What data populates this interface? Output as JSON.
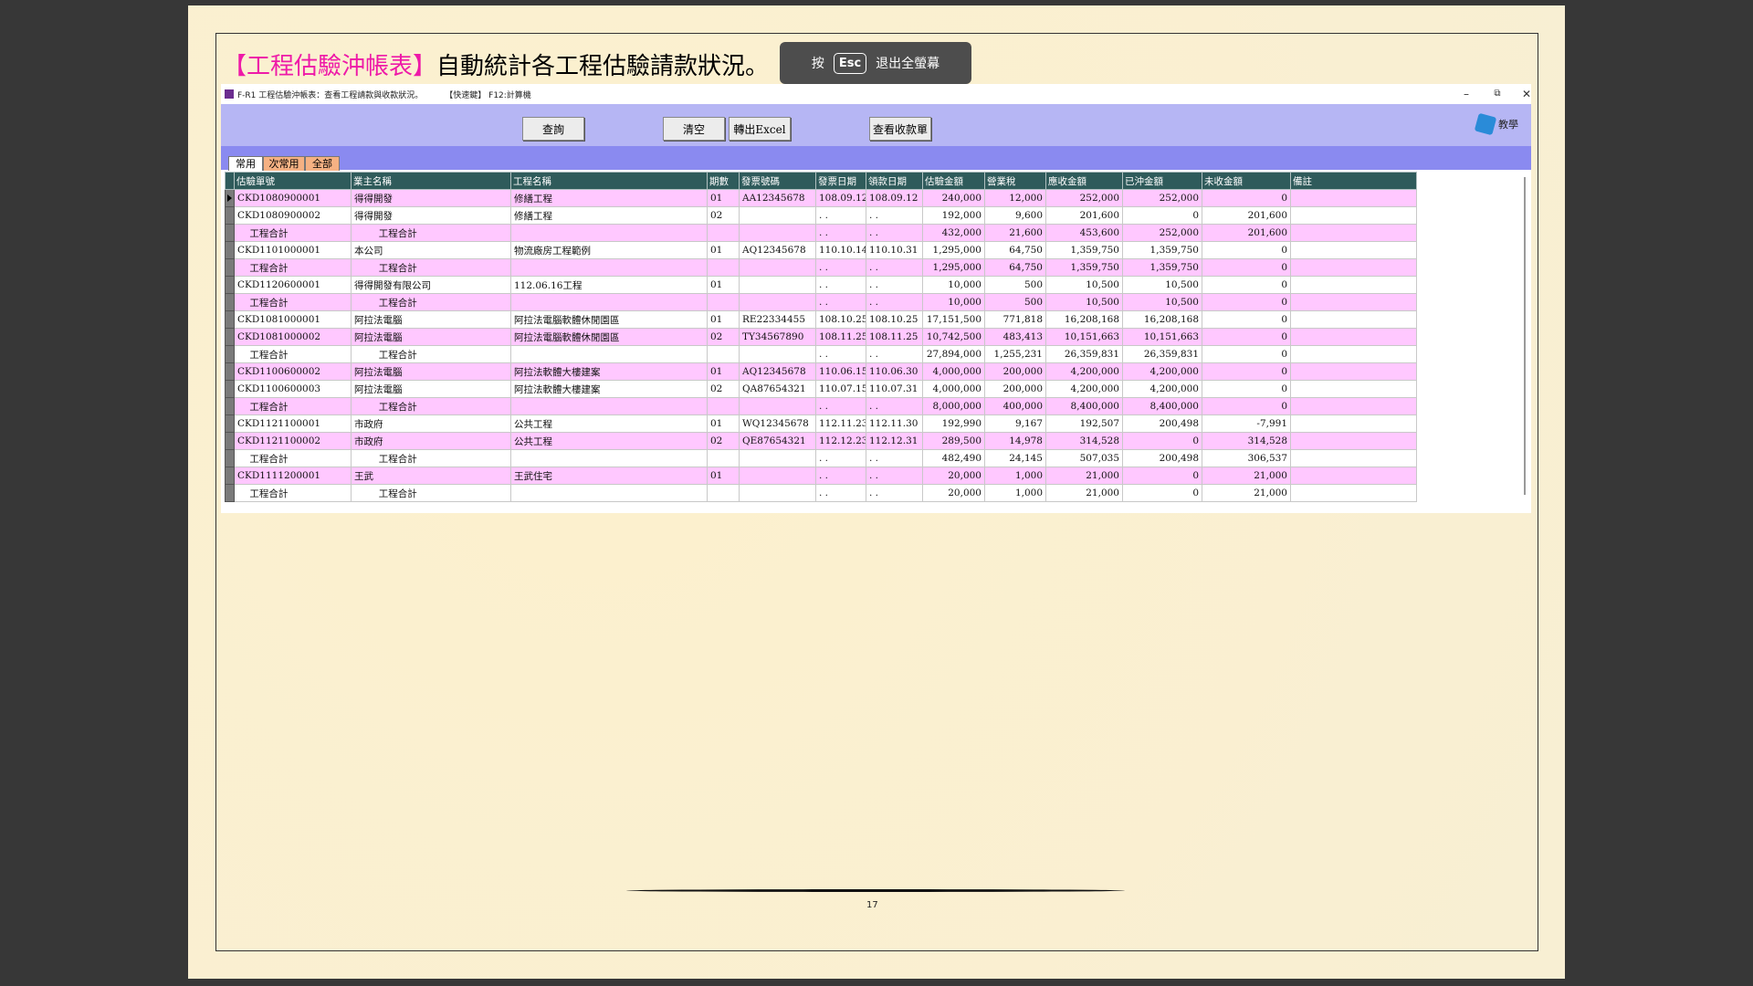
{
  "heading": {
    "bracket_title": "【工程估驗沖帳表】",
    "description": "自動統計各工程估驗請款狀況。"
  },
  "esc_hint": {
    "press": "按",
    "key": "Esc",
    "action": "退出全螢幕"
  },
  "window": {
    "title": "F-R1 工程估驗沖帳表：查看工程請款與收款狀況。",
    "hotkeys": "【快速鍵】 F12:計算機",
    "minimize": "–",
    "restore": "⧉",
    "close": "✕"
  },
  "toolbar": {
    "query": "查詢",
    "clear": "清空",
    "export": "轉出Excel",
    "view_receipts": "查看收款單",
    "help": "教學"
  },
  "tabs": [
    "常用",
    "次常用",
    "全部"
  ],
  "colors": {
    "toolbar": "#b6b6f4",
    "header": "#2f5b5b",
    "pink_row": "#ffc8ff",
    "accent": "#ee1aa8"
  },
  "table": {
    "columns": [
      "估驗單號",
      "業主名稱",
      "工程名稱",
      "期數",
      "發票號碼",
      "發票日期",
      "領款日期",
      "估驗金額",
      "營業稅",
      "應收金額",
      "已沖金額",
      "未收金額",
      "備註"
    ],
    "rows": [
      {
        "style": "pink",
        "c": [
          "CKD1080900001",
          "得得開發",
          "修繕工程",
          "01",
          "AA12345678",
          "108.09.12",
          "108.09.12",
          "240,000",
          "12,000",
          "252,000",
          "252,000",
          "0",
          ""
        ]
      },
      {
        "style": "white",
        "c": [
          "CKD1080900002",
          "得得開發",
          "修繕工程",
          "02",
          "",
          ". .",
          ". .",
          "192,000",
          "9,600",
          "201,600",
          "0",
          "201,600",
          ""
        ]
      },
      {
        "style": "pink",
        "c": [
          "    工程合計",
          "        工程合計",
          "",
          "",
          "",
          ". .",
          ". .",
          "432,000",
          "21,600",
          "453,600",
          "252,000",
          "201,600",
          ""
        ]
      },
      {
        "style": "white",
        "c": [
          "CKD1101000001",
          "本公司",
          "物流廠房工程範例",
          "01",
          "AQ12345678",
          "110.10.14",
          "110.10.31",
          "1,295,000",
          "64,750",
          "1,359,750",
          "1,359,750",
          "0",
          ""
        ]
      },
      {
        "style": "pink",
        "c": [
          "    工程合計",
          "        工程合計",
          "",
          "",
          "",
          ". .",
          ". .",
          "1,295,000",
          "64,750",
          "1,359,750",
          "1,359,750",
          "0",
          ""
        ]
      },
      {
        "style": "white",
        "c": [
          "CKD1120600001",
          "得得開發有限公司",
          "112.06.16工程",
          "01",
          "",
          ". .",
          ". .",
          "10,000",
          "500",
          "10,500",
          "10,500",
          "0",
          ""
        ]
      },
      {
        "style": "pink",
        "c": [
          "    工程合計",
          "        工程合計",
          "",
          "",
          "",
          ". .",
          ". .",
          "10,000",
          "500",
          "10,500",
          "10,500",
          "0",
          ""
        ]
      },
      {
        "style": "white",
        "c": [
          "CKD1081000001",
          "阿拉法電腦",
          "阿拉法電腦軟體休閒園區",
          "01",
          "RE22334455",
          "108.10.25",
          "108.10.25",
          "17,151,500",
          "771,818",
          "16,208,168",
          "16,208,168",
          "0",
          ""
        ]
      },
      {
        "style": "pink",
        "c": [
          "CKD1081000002",
          "阿拉法電腦",
          "阿拉法電腦軟體休閒園區",
          "02",
          "TY34567890",
          "108.11.25",
          "108.11.25",
          "10,742,500",
          "483,413",
          "10,151,663",
          "10,151,663",
          "0",
          ""
        ]
      },
      {
        "style": "white",
        "c": [
          "    工程合計",
          "        工程合計",
          "",
          "",
          "",
          ". .",
          ". .",
          "27,894,000",
          "1,255,231",
          "26,359,831",
          "26,359,831",
          "0",
          ""
        ]
      },
      {
        "style": "pink",
        "c": [
          "CKD1100600002",
          "阿拉法電腦",
          "阿拉法軟體大樓建案",
          "01",
          "AQ12345678",
          "110.06.15",
          "110.06.30",
          "4,000,000",
          "200,000",
          "4,200,000",
          "4,200,000",
          "0",
          ""
        ]
      },
      {
        "style": "white",
        "c": [
          "CKD1100600003",
          "阿拉法電腦",
          "阿拉法軟體大樓建案",
          "02",
          "QA87654321",
          "110.07.15",
          "110.07.31",
          "4,000,000",
          "200,000",
          "4,200,000",
          "4,200,000",
          "0",
          ""
        ]
      },
      {
        "style": "pink",
        "c": [
          "    工程合計",
          "        工程合計",
          "",
          "",
          "",
          ". .",
          ". .",
          "8,000,000",
          "400,000",
          "8,400,000",
          "8,400,000",
          "0",
          ""
        ]
      },
      {
        "style": "white",
        "c": [
          "CKD1121100001",
          "市政府",
          "公共工程",
          "01",
          "WQ12345678",
          "112.11.23",
          "112.11.30",
          "192,990",
          "9,167",
          "192,507",
          "200,498",
          "-7,991",
          ""
        ]
      },
      {
        "style": "pink",
        "c": [
          "CKD1121100002",
          "市政府",
          "公共工程",
          "02",
          "QE87654321",
          "112.12.23",
          "112.12.31",
          "289,500",
          "14,978",
          "314,528",
          "0",
          "314,528",
          ""
        ]
      },
      {
        "style": "white",
        "c": [
          "    工程合計",
          "        工程合計",
          "",
          "",
          "",
          ". .",
          ". .",
          "482,490",
          "24,145",
          "507,035",
          "200,498",
          "306,537",
          ""
        ]
      },
      {
        "style": "pink",
        "c": [
          "CKD1111200001",
          "王武",
          "王武住宅",
          "01",
          "",
          ". .",
          ". .",
          "20,000",
          "1,000",
          "21,000",
          "0",
          "21,000",
          ""
        ]
      },
      {
        "style": "white",
        "c": [
          "    工程合計",
          "        工程合計",
          "",
          "",
          "",
          ". .",
          ". .",
          "20,000",
          "1,000",
          "21,000",
          "0",
          "21,000",
          ""
        ]
      }
    ]
  },
  "footer": {
    "page_number": "17"
  }
}
